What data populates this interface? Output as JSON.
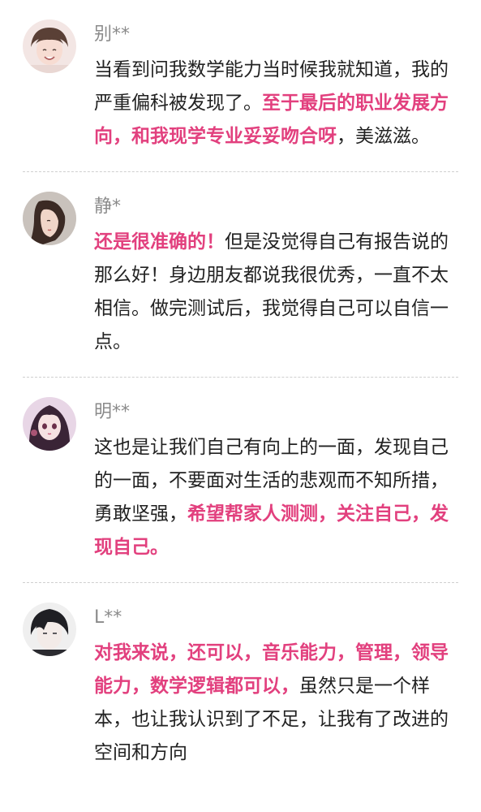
{
  "colors": {
    "highlight": "#e2407e",
    "name": "#8a8a8a",
    "text": "#222222"
  },
  "comments": [
    {
      "name": "别**",
      "avatar": "avatar-boy-smiling",
      "segments": [
        {
          "text": "当看到问我数学能力当时候我就知道，我的严重偏科被发现了。",
          "highlight": false
        },
        {
          "text": "至于最后的职业发展方向，和我现学专业妥妥吻合呀",
          "highlight": true
        },
        {
          "text": "，美滋滋。",
          "highlight": false
        }
      ]
    },
    {
      "name": "静*",
      "avatar": "avatar-girl-profile",
      "segments": [
        {
          "text": "还是很准确的！",
          "highlight": true
        },
        {
          "text": "但是没觉得自己有报告说的那么好！身边朋友都说我很优秀，一直不太相信。做完测试后，我觉得自己可以自信一点。",
          "highlight": false
        }
      ]
    },
    {
      "name": "明**",
      "avatar": "avatar-anime-girl",
      "segments": [
        {
          "text": "这也是让我们自己有向上的一面，发现自己的一面，不要面对生活的悲观而不知所措，勇敢坚强，",
          "highlight": false
        },
        {
          "text": "希望帮家人测测，关注自己，发现自己。",
          "highlight": true
        }
      ]
    },
    {
      "name": "L**",
      "avatar": "avatar-anime-boy",
      "segments": [
        {
          "text": "对我来说，还可以，音乐能力，管理，领导能力，数学逻辑都可以，",
          "highlight": true
        },
        {
          "text": "虽然只是一个样本，也让我认识到了不足，让我有了改进的空间和方向",
          "highlight": false
        }
      ]
    }
  ]
}
